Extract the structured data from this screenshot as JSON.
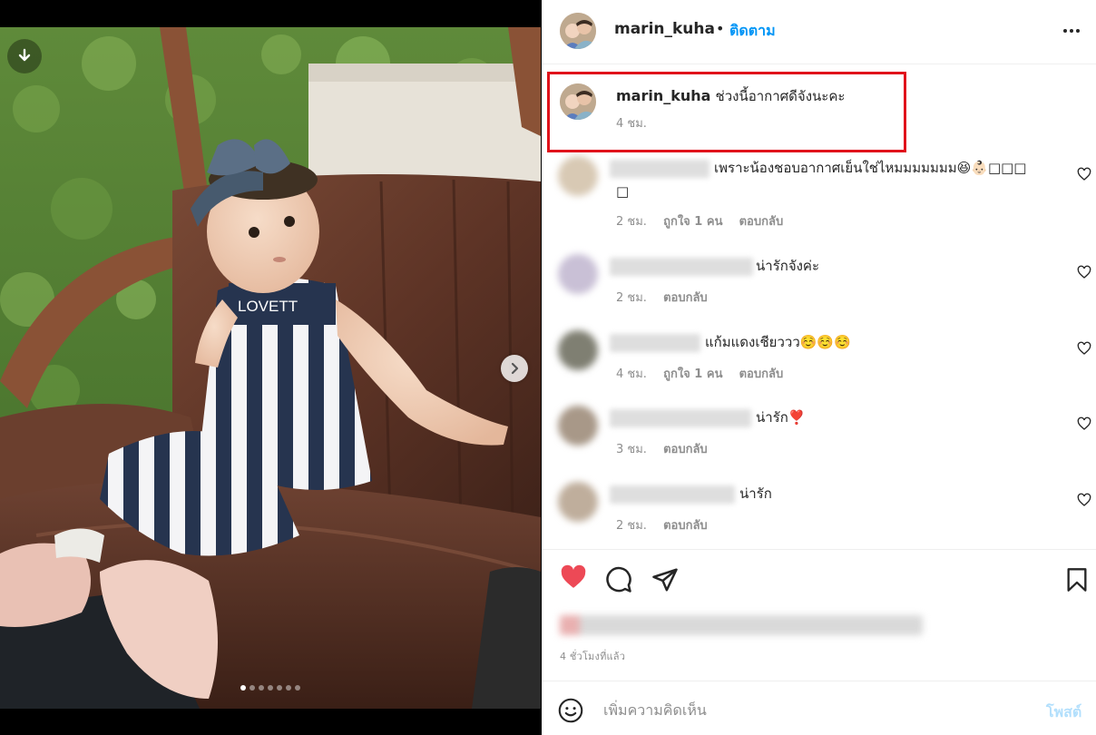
{
  "post": {
    "username": "marin_kuha",
    "separator": "•",
    "follow_label": "ติดตาม",
    "more_icon": "more-horizontal-icon",
    "carousel": {
      "slide_count": 7,
      "active_index": 0
    },
    "image_text": "LOVETT",
    "caption": {
      "username": "marin_kuha",
      "text": "ช่วงนี้อากาศดีจังนะคะ",
      "time": "4 ชม."
    }
  },
  "comments": [
    {
      "text": "เพราะน้องชอบอากาศเย็นใช่ไหมมมมมมม😆👶🏻□□□",
      "text_line2": "□",
      "time": "2 ชม.",
      "likes": "ถูกใจ 1 คน",
      "reply": "ตอบกลับ"
    },
    {
      "text": "น่ารักจังค่ะ",
      "time": "2 ชม.",
      "likes": "",
      "reply": "ตอบกลับ"
    },
    {
      "text": "แก้มแดงเชียววว☺️☺️☺️",
      "time": "4 ชม.",
      "likes": "ถูกใจ 1 คน",
      "reply": "ตอบกลับ"
    },
    {
      "text": "น่ารัก❣️",
      "time": "3 ชม.",
      "likes": "",
      "reply": "ตอบกลับ"
    },
    {
      "text": "น่ารัก",
      "time": "2 ชม.",
      "likes": "",
      "reply": "ตอบกลับ"
    }
  ],
  "actions": {
    "liked": true,
    "like_color": "#ed4956",
    "time_ago": "4 ชั่วโมงที่แล้ว"
  },
  "add_comment": {
    "placeholder": "เพิ่มความคิดเห็น",
    "post_label": "โพสต์",
    "post_color": "#b2dffc"
  },
  "colors": {
    "accent": "#0095f6",
    "highlight_box": "#e0121b",
    "meta_gray": "#8e8e8e"
  }
}
